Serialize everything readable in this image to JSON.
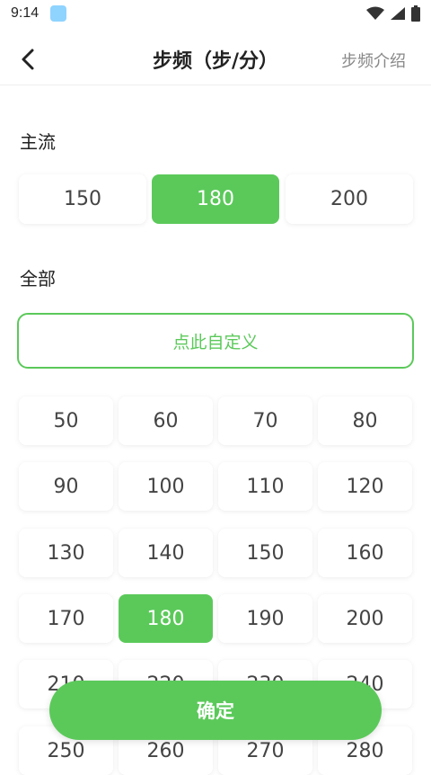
{
  "status_bar": {
    "time": "9:14"
  },
  "header": {
    "back_icon": "chevron-left-icon",
    "title": "步频（步/分）",
    "right_link": "步频介绍"
  },
  "sections": {
    "mainstream_label": "主流",
    "all_label": "全部"
  },
  "mainstream": [
    "150",
    "180",
    "200"
  ],
  "mainstream_selected": "180",
  "custom_button": "点此自定义",
  "all_values": [
    "50",
    "60",
    "70",
    "80",
    "90",
    "100",
    "110",
    "120",
    "130",
    "140",
    "150",
    "160",
    "170",
    "180",
    "190",
    "200",
    "210",
    "220",
    "230",
    "240",
    "250",
    "260",
    "270",
    "280"
  ],
  "all_selected": "180",
  "confirm_label": "确定",
  "colors": {
    "accent": "#5bc95a"
  }
}
